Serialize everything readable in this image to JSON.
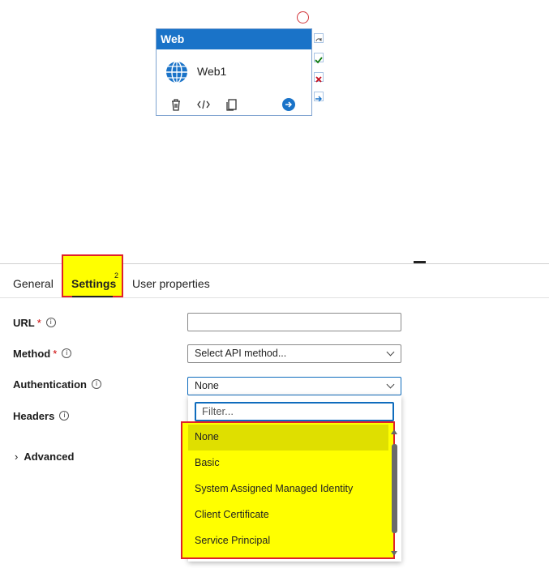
{
  "activity": {
    "header": "Web",
    "name": "Web1",
    "tools": [
      "delete-icon",
      "code-icon",
      "copy-icon",
      "go-arrow-icon"
    ],
    "status_icons": [
      "skip-icon",
      "success-check-icon",
      "failure-x-icon",
      "completion-arrow-icon"
    ]
  },
  "tabs": {
    "general": "General",
    "settings": "Settings",
    "settings_badge": "2",
    "user_properties": "User properties"
  },
  "form": {
    "url_label": "URL",
    "url_value": "",
    "method_label": "Method",
    "method_value": "Select API method...",
    "auth_label": "Authentication",
    "auth_value": "None",
    "headers_label": "Headers",
    "advanced_label": "Advanced",
    "required_mark": "*",
    "info_glyph": "i"
  },
  "dropdown": {
    "filter_placeholder": "Filter...",
    "options": [
      "None",
      "Basic",
      "System Assigned Managed Identity",
      "Client Certificate",
      "Service Principal"
    ],
    "selected": "None"
  },
  "colors": {
    "accent": "#1a73c8",
    "highlight": "#ffff00",
    "highlight_border": "#e0202a",
    "selected_row": "#dfdf00"
  }
}
